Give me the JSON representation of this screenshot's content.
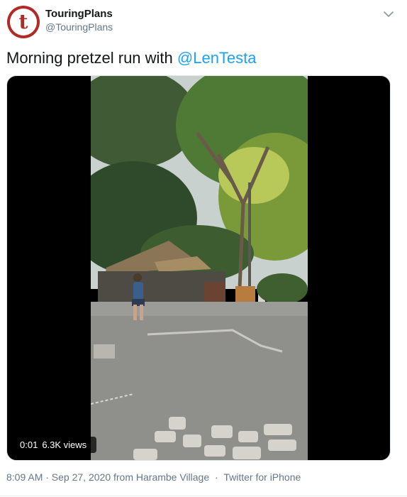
{
  "tweet": {
    "display_name": "TouringPlans",
    "handle": "@TouringPlans",
    "avatar_letter": "t",
    "text_prefix": "Morning pretzel run with ",
    "mention": "@LenTesta",
    "timestamp": "8:09 AM · Sep 27, 2020",
    "location": "from Harambe Village",
    "meta_separator": "·",
    "source": "Twitter for iPhone"
  },
  "video": {
    "elapsed": "0:01",
    "views": "6.3K views"
  },
  "icons": {
    "caret": "chevron-down-icon",
    "avatar": "touringplans-logo"
  },
  "colors": {
    "brand_red": "#b02a26",
    "link_blue": "#1da1f2",
    "muted_gray": "#657786"
  }
}
